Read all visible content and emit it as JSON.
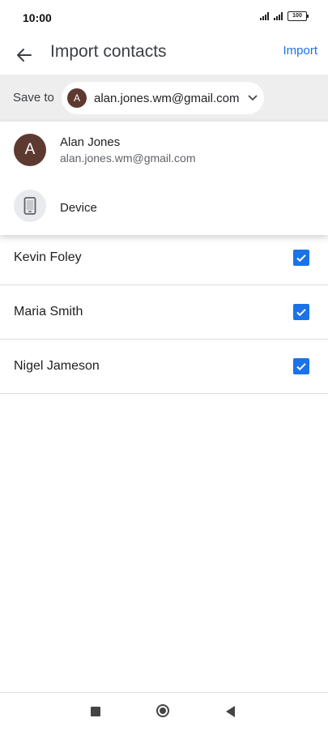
{
  "status_bar": {
    "time": "10:00",
    "battery": "100"
  },
  "app_bar": {
    "title": "Import contacts",
    "action_label": "Import",
    "back_icon": "arrow-back-icon"
  },
  "save_to": {
    "label": "Save to",
    "selected_account": {
      "initial": "A",
      "email": "alan.jones.wm@gmail.com"
    }
  },
  "dropdown": {
    "items": [
      {
        "initial": "A",
        "name": "Alan Jones",
        "email": "alan.jones.wm@gmail.com"
      },
      {
        "icon": "phone-icon",
        "name": "Device"
      }
    ]
  },
  "contacts": [
    {
      "name": "Kevin Foley",
      "checked": true
    },
    {
      "name": "Maria Smith",
      "checked": true
    },
    {
      "name": "Nigel Jameson",
      "checked": true
    }
  ],
  "colors": {
    "accent": "#1a73e8",
    "avatar": "#5d3a30",
    "bar_bg": "#eeeeee"
  }
}
